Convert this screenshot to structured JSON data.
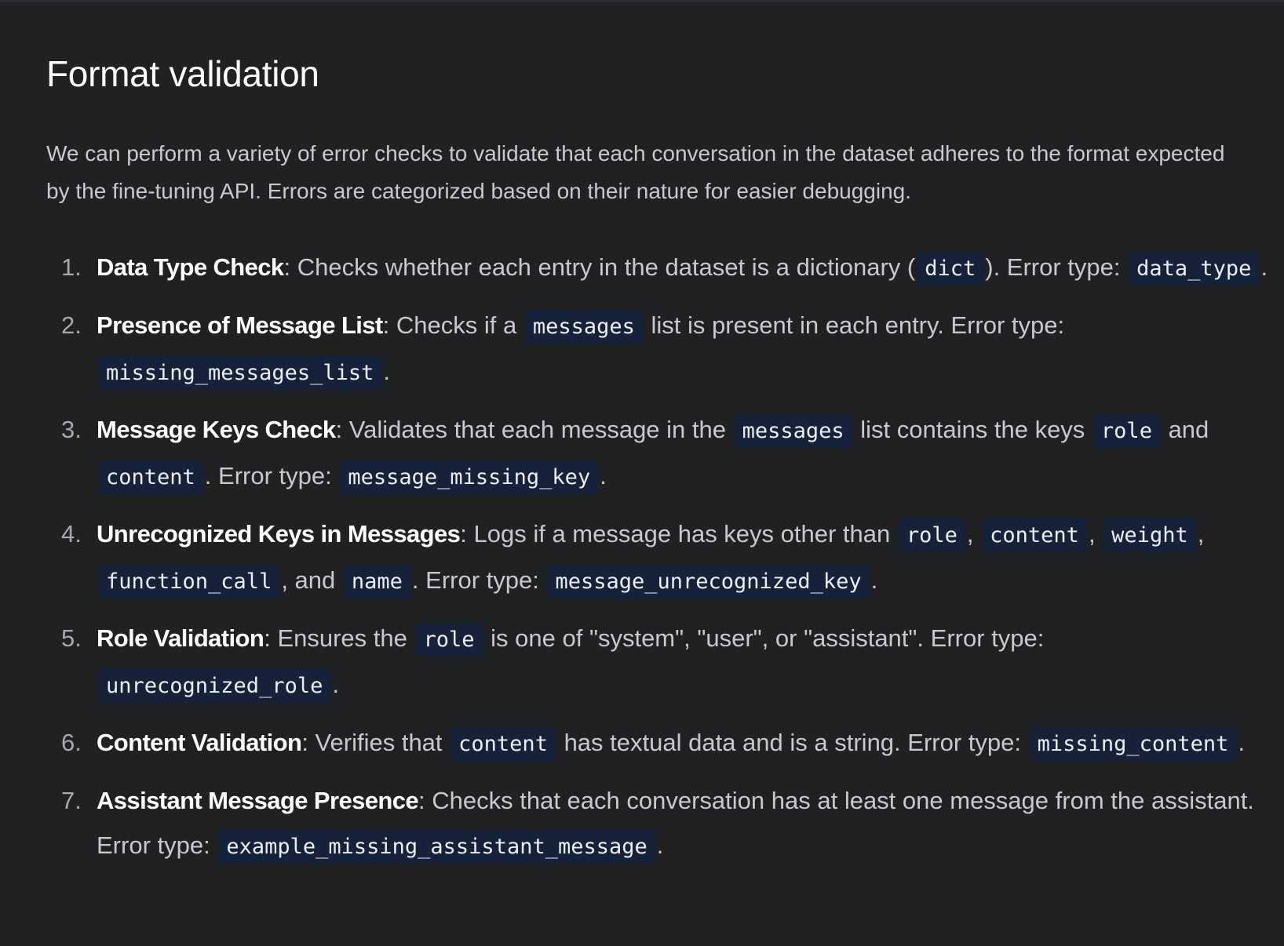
{
  "title": "Format validation",
  "intro": "We can perform a variety of error checks to validate that each conversation in the dataset adheres to the format expected by the fine-tuning API. Errors are categorized based on their nature for easier debugging.",
  "items": [
    {
      "num": "1.",
      "term": "Data Type Check",
      "t1": ": Checks whether each entry in the dataset is a dictionary (",
      "c1": "dict",
      "t2": "). Error type: ",
      "c2": "data_type",
      "t3": "."
    },
    {
      "num": "2.",
      "term": "Presence of Message List",
      "t1": ": Checks if a ",
      "c1": "messages",
      "t2": " list is present in each entry. Error type: ",
      "c2": "missing_messages_list",
      "t3": "."
    },
    {
      "num": "3.",
      "term": "Message Keys Check",
      "t1": ": Validates that each message in the ",
      "c1": "messages",
      "t2": " list contains the keys ",
      "c2": "role",
      "t3": " and ",
      "c3": "content",
      "t4": ". Error type: ",
      "c4": "message_missing_key",
      "t5": "."
    },
    {
      "num": "4.",
      "term": "Unrecognized Keys in Messages",
      "t1": ": Logs if a message has keys other than ",
      "c1": "role",
      "t2": ", ",
      "c2": "content",
      "t3": ", ",
      "c3": "weight",
      "t4": ", ",
      "c4": "function_call",
      "t5": ", and ",
      "c5": "name",
      "t6": ". Error type: ",
      "c6": "message_unrecognized_key",
      "t7": "."
    },
    {
      "num": "5.",
      "term": "Role Validation",
      "t1": ": Ensures the ",
      "c1": "role",
      "t2": " is one of \"system\", \"user\", or \"assistant\". Error type: ",
      "c2": "unrecognized_role",
      "t3": "."
    },
    {
      "num": "6.",
      "term": "Content Validation",
      "t1": ": Verifies that ",
      "c1": "content",
      "t2": " has textual data and is a string. Error type: ",
      "c2": "missing_content",
      "t3": "."
    },
    {
      "num": "7.",
      "term": "Assistant Message Presence",
      "t1": ": Checks that each conversation has at least one message from the assistant. Error type: ",
      "c1": "example_missing_assistant_message",
      "t2": "."
    }
  ]
}
